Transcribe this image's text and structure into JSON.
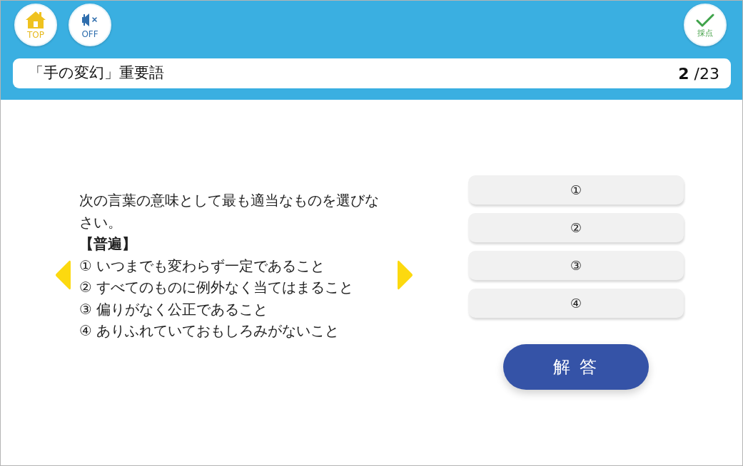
{
  "toolbar": {
    "home": {
      "label": "TOP"
    },
    "sound": {
      "label": "OFF",
      "muted": true
    },
    "grade": {
      "label": "採点"
    }
  },
  "title_bar": {
    "title": "「手の変幻」重要語",
    "counter": "**2** /23"
  },
  "question": {
    "instruction": "次の言葉の意味として最も適当なものを選びなさい。",
    "term": "【普遍】",
    "options": [
      "① いつまでも変わらず一定であること",
      "② すべてのものに例外なく当てはまること",
      "③ 偏りがなく公正であること",
      "④ ありふれていておもしろみがないこと"
    ]
  },
  "choices": [
    {
      "label": "①",
      "selected": false
    },
    {
      "label": "②",
      "selected": false
    },
    {
      "label": "③",
      "selected": false
    },
    {
      "label": "④",
      "selected": false
    }
  ],
  "answer_button": {
    "label": "解 答"
  }
}
